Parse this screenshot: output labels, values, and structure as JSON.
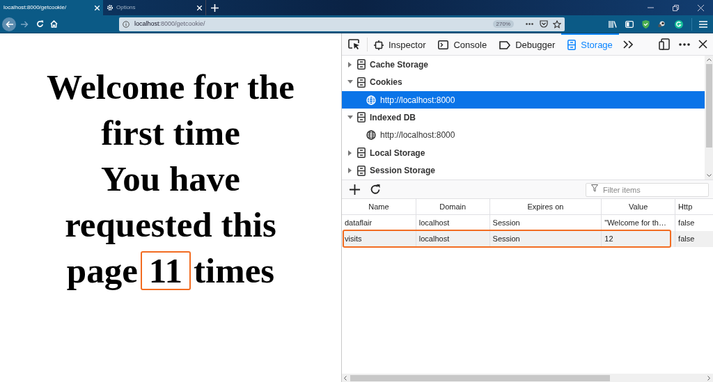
{
  "browser": {
    "tabs": [
      {
        "label": "localhost:8000/getcookie/",
        "selected": true
      },
      {
        "label": "Options",
        "selected": false
      }
    ],
    "url": {
      "host": "localhost",
      "rest": ":8000/getcookie/"
    },
    "zoom": "270%"
  },
  "page": {
    "lines": [
      "Welcome for the",
      "first time",
      "You have",
      "requested this"
    ],
    "last_line": {
      "before": "page",
      "count": "11",
      "after": "times"
    }
  },
  "devtools": {
    "tabs": [
      {
        "label": "Inspector",
        "selected": false,
        "kind": "inspector"
      },
      {
        "label": "Console",
        "selected": false,
        "kind": "console"
      },
      {
        "label": "Debugger",
        "selected": false,
        "kind": "debugger"
      },
      {
        "label": "Storage",
        "selected": true,
        "kind": "storage"
      }
    ],
    "tree": [
      {
        "label": "Cache Storage",
        "expanded": false
      },
      {
        "label": "Cookies",
        "expanded": true,
        "children": [
          {
            "label": "http://localhost:8000",
            "selected": true
          }
        ]
      },
      {
        "label": "Indexed DB",
        "expanded": true,
        "children": [
          {
            "label": "http://localhost:8000",
            "selected": false
          }
        ]
      },
      {
        "label": "Local Storage",
        "expanded": false
      },
      {
        "label": "Session Storage",
        "expanded": false
      }
    ],
    "filter": {
      "placeholder": "Filter items"
    },
    "table": {
      "columns": [
        "Name",
        "Domain",
        "Expires on",
        "Value",
        "Http"
      ],
      "rows": [
        {
          "cells": [
            "dataflair",
            "localhost",
            "Session",
            "\"Welcome for th…",
            "false"
          ],
          "selected": false
        },
        {
          "cells": [
            "visits",
            "localhost",
            "Session",
            "12",
            "false"
          ],
          "selected": true
        }
      ]
    }
  }
}
